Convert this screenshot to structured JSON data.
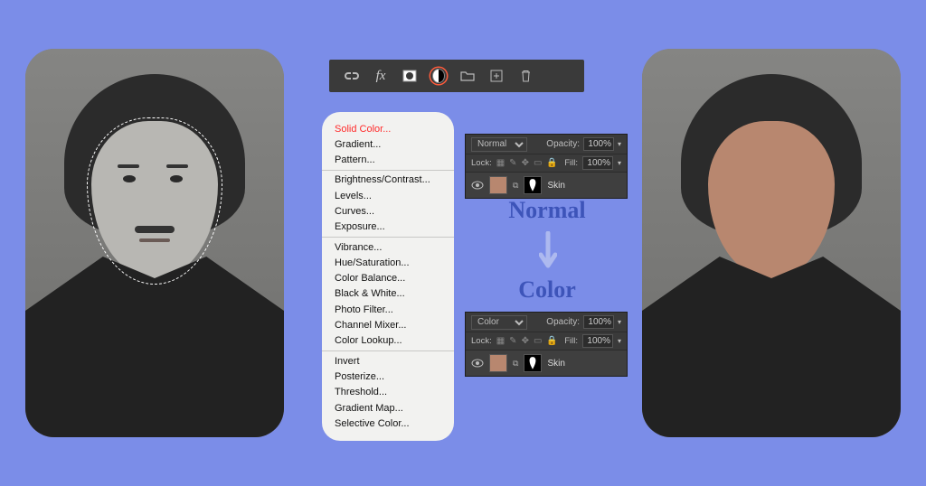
{
  "toolbar": {
    "icons": [
      "link-icon",
      "fx-icon",
      "mask-icon",
      "adjustment-layer-icon",
      "group-icon",
      "new-layer-icon",
      "delete-icon"
    ],
    "selected": "adjustment-layer-icon"
  },
  "adjustment_menu": {
    "groups": [
      [
        "Solid Color...",
        "Gradient...",
        "Pattern..."
      ],
      [
        "Brightness/Contrast...",
        "Levels...",
        "Curves...",
        "Exposure..."
      ],
      [
        "Vibrance...",
        "Hue/Saturation...",
        "Color Balance...",
        "Black & White...",
        "Photo Filter...",
        "Channel Mixer...",
        "Color Lookup..."
      ],
      [
        "Invert",
        "Posterize...",
        "Threshold...",
        "Gradient Map...",
        "Selective Color..."
      ]
    ],
    "selected": "Solid Color..."
  },
  "layers_panel_top": {
    "blend_mode": "Normal",
    "opacity_label": "Opacity:",
    "opacity_value": "100%",
    "lock_label": "Lock:",
    "fill_label": "Fill:",
    "fill_value": "100%",
    "layer_name": "Skin",
    "thumb_color": "#b8876f"
  },
  "layers_panel_bottom": {
    "blend_mode": "Color",
    "opacity_label": "Opacity:",
    "opacity_value": "100%",
    "lock_label": "Lock:",
    "fill_label": "Fill:",
    "fill_value": "100%",
    "layer_name": "Skin",
    "thumb_color": "#b8876f"
  },
  "center_labels": {
    "from": "Normal",
    "to": "Color"
  },
  "arrow_color": "#adb9ef"
}
